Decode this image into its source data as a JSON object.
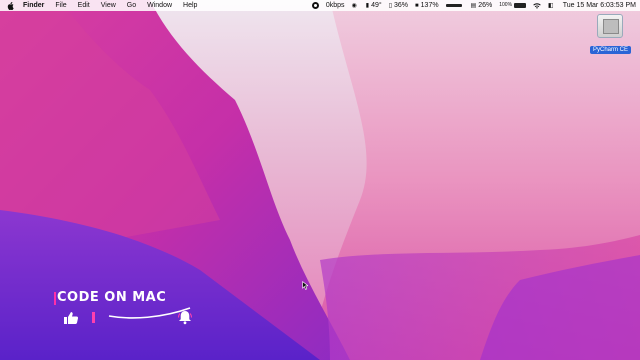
{
  "menubar": {
    "apple_icon": "apple-icon",
    "app_name": "Finder",
    "menus": [
      "File",
      "Edit",
      "View",
      "Go",
      "Window",
      "Help"
    ],
    "status": {
      "network_speed": "0kbps",
      "temperature": "49°",
      "cpu_percent": "36%",
      "disk_value": "137%",
      "memory_percent": "26%",
      "battery_percent": "100%",
      "datetime": "Tue 15 Mar  6:03:53 PM"
    }
  },
  "desktop": {
    "icons": [
      {
        "label": "PyCharm CE",
        "icon": "disk-image-icon"
      }
    ]
  },
  "watermark": {
    "title": "CODE ON MAC",
    "like_icon": "thumbs-up-icon",
    "bell_icon": "bell-icon"
  },
  "colors": {
    "wallpaper_top": "#ece6ee",
    "wallpaper_pink": "#e04a9c",
    "wallpaper_purple": "#6a2fd2",
    "accent_pink": "#ff3fae",
    "icon_label_bg": "#2a64d6"
  }
}
